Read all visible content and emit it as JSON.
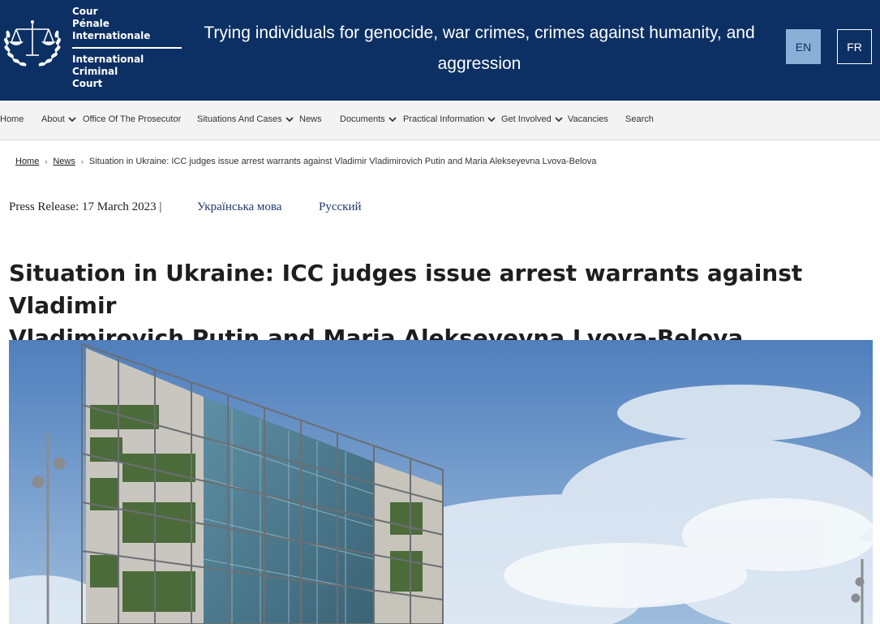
{
  "header": {
    "logo_fr": [
      "Cour",
      "Pénale",
      "Internationale"
    ],
    "logo_en": [
      "International",
      "Criminal",
      "Court"
    ],
    "tagline": "Trying individuals for genocide, war crimes, crimes against humanity, and aggression",
    "lang_en": "EN",
    "lang_fr": "FR",
    "colors": {
      "brand": "#0c3063",
      "active_lang": "#8bb0d8"
    }
  },
  "nav": {
    "items": [
      {
        "label": "Home",
        "dropdown": false
      },
      {
        "label": "About",
        "dropdown": true
      },
      {
        "label": "Office Of The Prosecutor",
        "dropdown": false
      },
      {
        "label": "Situations And Cases",
        "dropdown": true
      },
      {
        "label": "News",
        "dropdown": false
      },
      {
        "label": "Documents",
        "dropdown": true
      },
      {
        "label": "Practical Information",
        "dropdown": true
      },
      {
        "label": "Get Involved",
        "dropdown": true
      },
      {
        "label": "Vacancies",
        "dropdown": false
      },
      {
        "label": "Search",
        "dropdown": false
      }
    ]
  },
  "breadcrumb": {
    "home": "Home",
    "news": "News",
    "current": "Situation in Ukraine: ICC judges issue arrest warrants against Vladimir Vladimirovich Putin and Maria Alekseyevna Lvova-Belova",
    "separator": "›"
  },
  "meta": {
    "press_release": "Press Release: 17 March 2023 |",
    "lang_ukrainian": "Українська мова",
    "lang_russian": "Русский"
  },
  "article": {
    "title_line1": "Situation in Ukraine: ICC judges issue arrest warrants against Vladimir",
    "title_line2": "Vladimirovich Putin and Maria Alekseyevna Lvova-Belova"
  }
}
